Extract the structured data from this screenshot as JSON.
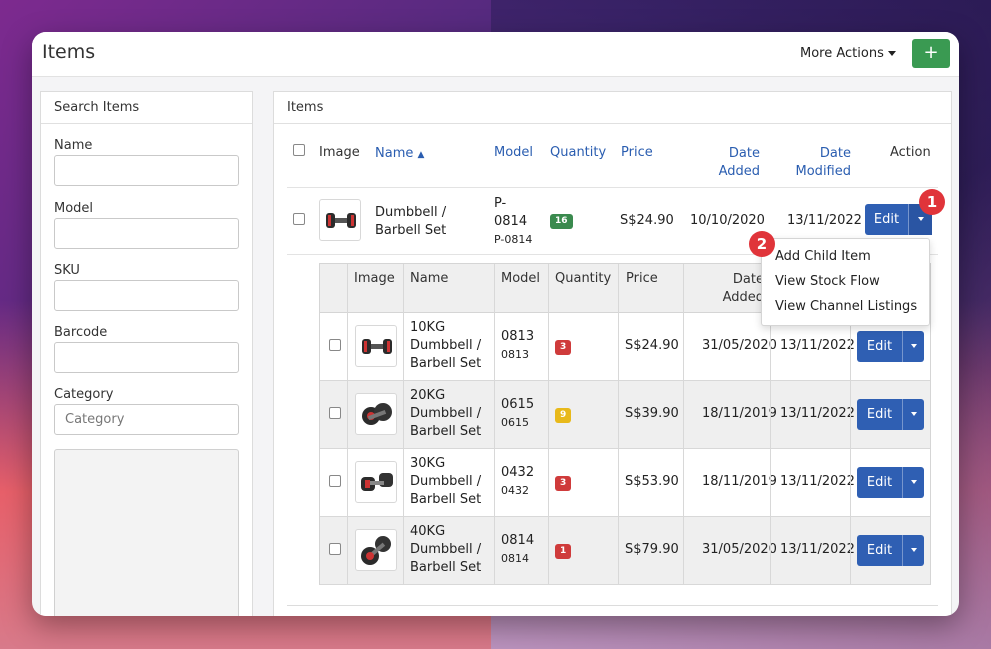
{
  "header": {
    "title": "Items",
    "more_actions": "More Actions",
    "add_label": "+"
  },
  "search": {
    "title": "Search Items",
    "fields": [
      {
        "label": "Name",
        "value": ""
      },
      {
        "label": "Model",
        "value": ""
      },
      {
        "label": "SKU",
        "value": ""
      },
      {
        "label": "Barcode",
        "value": ""
      }
    ],
    "category_label": "Category",
    "category_placeholder": "Category"
  },
  "items": {
    "title": "Items",
    "columns": {
      "image": "Image",
      "name": "Name",
      "name_sort": "▲",
      "model": "Model",
      "quantity": "Quantity",
      "price": "Price",
      "date_added_1": "Date",
      "date_added_2": "Added",
      "date_modified_1": "Date",
      "date_modified_2": "Modified",
      "action": "Action"
    },
    "parent": {
      "name_1": "Dumbbell /",
      "name_2": "Barbell Set",
      "model_1": "P-",
      "model_2": "0814",
      "sku": "P-0814",
      "quantity": "16",
      "price": "S$24.90",
      "date_added": "10/10/2020",
      "date_modified": "13/11/2022",
      "edit": "Edit"
    },
    "child_columns": {
      "image": "Image",
      "name": "Name",
      "model": "Model",
      "quantity": "Quantity",
      "price": "Price",
      "date_1": "Date",
      "date_2": "Added"
    },
    "children": [
      {
        "name_1": "10KG",
        "name_2": "Dumbbell /",
        "name_3": "Barbell Set",
        "model": "0813",
        "sku": "0813",
        "quantity": "3",
        "price": "S$24.90",
        "date_added": "31/05/2020",
        "date_modified": "13/11/2022",
        "edit": "Edit"
      },
      {
        "name_1": "20KG",
        "name_2": "Dumbbell /",
        "name_3": "Barbell Set",
        "model": "0615",
        "sku": "0615",
        "quantity": "9",
        "price": "S$39.90",
        "date_added": "18/11/2019",
        "date_modified": "13/11/2022",
        "edit": "Edit"
      },
      {
        "name_1": "30KG",
        "name_2": "Dumbbell /",
        "name_3": "Barbell Set",
        "model": "0432",
        "sku": "0432",
        "quantity": "3",
        "price": "S$53.90",
        "date_added": "18/11/2019",
        "date_modified": "13/11/2022",
        "edit": "Edit"
      },
      {
        "name_1": "40KG",
        "name_2": "Dumbbell /",
        "name_3": "Barbell Set",
        "model": "0814",
        "sku": "0814",
        "quantity": "1",
        "price": "S$79.90",
        "date_added": "31/05/2020",
        "date_modified": "13/11/2022",
        "edit": "Edit"
      }
    ]
  },
  "dropdown": {
    "items": [
      "Add Child Item",
      "View Stock Flow",
      "View Channel Listings"
    ]
  },
  "markers": [
    "1",
    "2"
  ],
  "colors": {
    "primary": "#2f5fb3",
    "success": "#3a9a52",
    "danger": "#cf3b3b",
    "warning": "#e8b91a",
    "link": "#2a5db0"
  }
}
